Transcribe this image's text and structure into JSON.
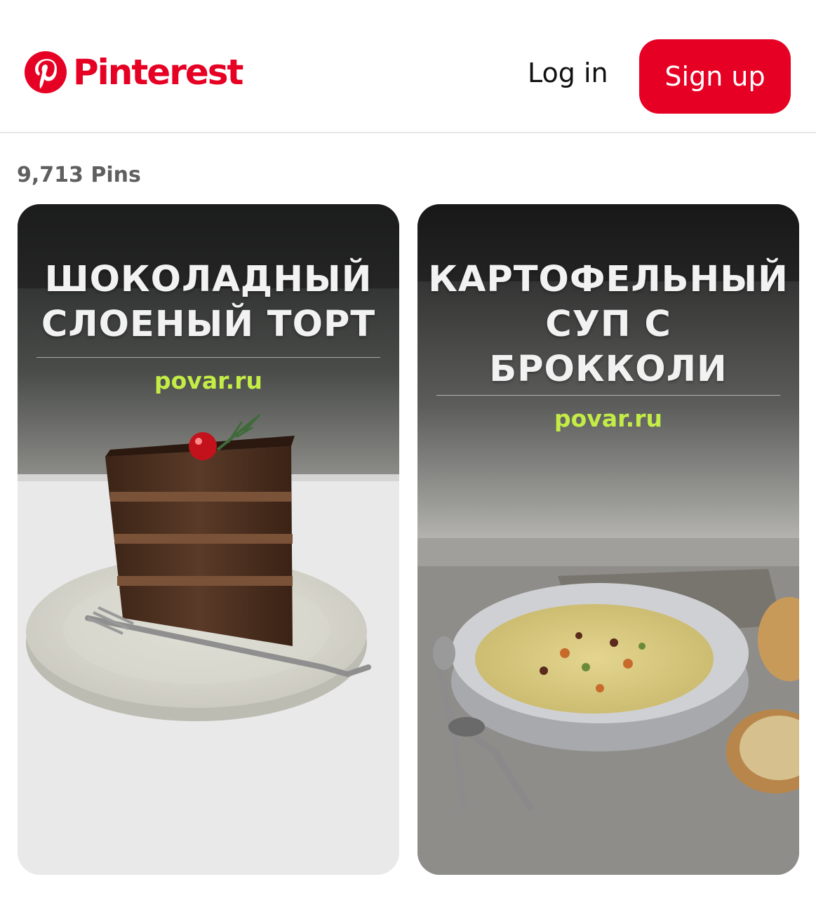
{
  "header": {
    "brand": "Pinterest",
    "login_label": "Log in",
    "signup_label": "Sign up"
  },
  "board": {
    "pins_count": "9,713 Pins"
  },
  "pins": [
    {
      "title_lines": [
        "ШОКОЛАДНЫЙ",
        "СЛОЕНЫЙ ТОРТ"
      ],
      "source": "povar.ru"
    },
    {
      "title_lines": [
        "КАРТОФЕЛЬНЫЙ",
        "СУП С",
        "БРОККОЛИ"
      ],
      "source": "povar.ru"
    }
  ],
  "colors": {
    "brand": "#e60023",
    "source_text": "#c4ec46",
    "pins_count_text": "#5f5f5f"
  }
}
